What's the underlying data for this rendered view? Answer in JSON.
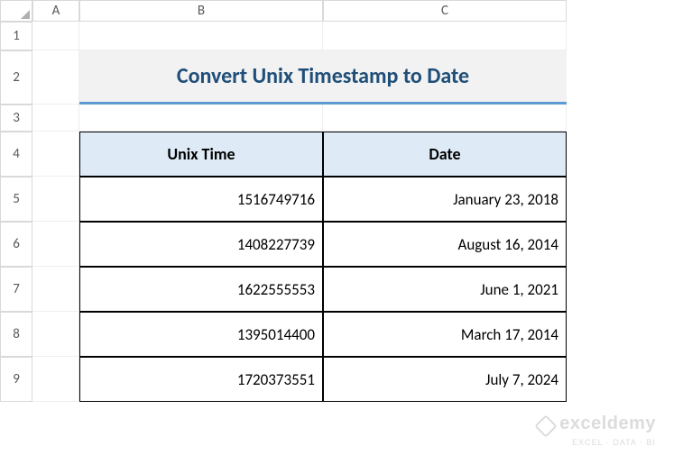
{
  "columns": [
    "A",
    "B",
    "C"
  ],
  "rows": [
    "1",
    "2",
    "3",
    "4",
    "5",
    "6",
    "7",
    "8",
    "9"
  ],
  "title": "Convert Unix Timestamp to Date",
  "headers": {
    "col_b": "Unix Time",
    "col_c": "Date"
  },
  "data": [
    {
      "unix": "1516749716",
      "date": "January 23, 2018"
    },
    {
      "unix": "1408227739",
      "date": "August 16, 2014"
    },
    {
      "unix": "1622555553",
      "date": "June 1, 2021"
    },
    {
      "unix": "1395014400",
      "date": "March 17, 2014"
    },
    {
      "unix": "1720373551",
      "date": "July 7, 2024"
    }
  ],
  "watermark": {
    "main": "exceldemy",
    "sub": "EXCEL · DATA · BI"
  }
}
